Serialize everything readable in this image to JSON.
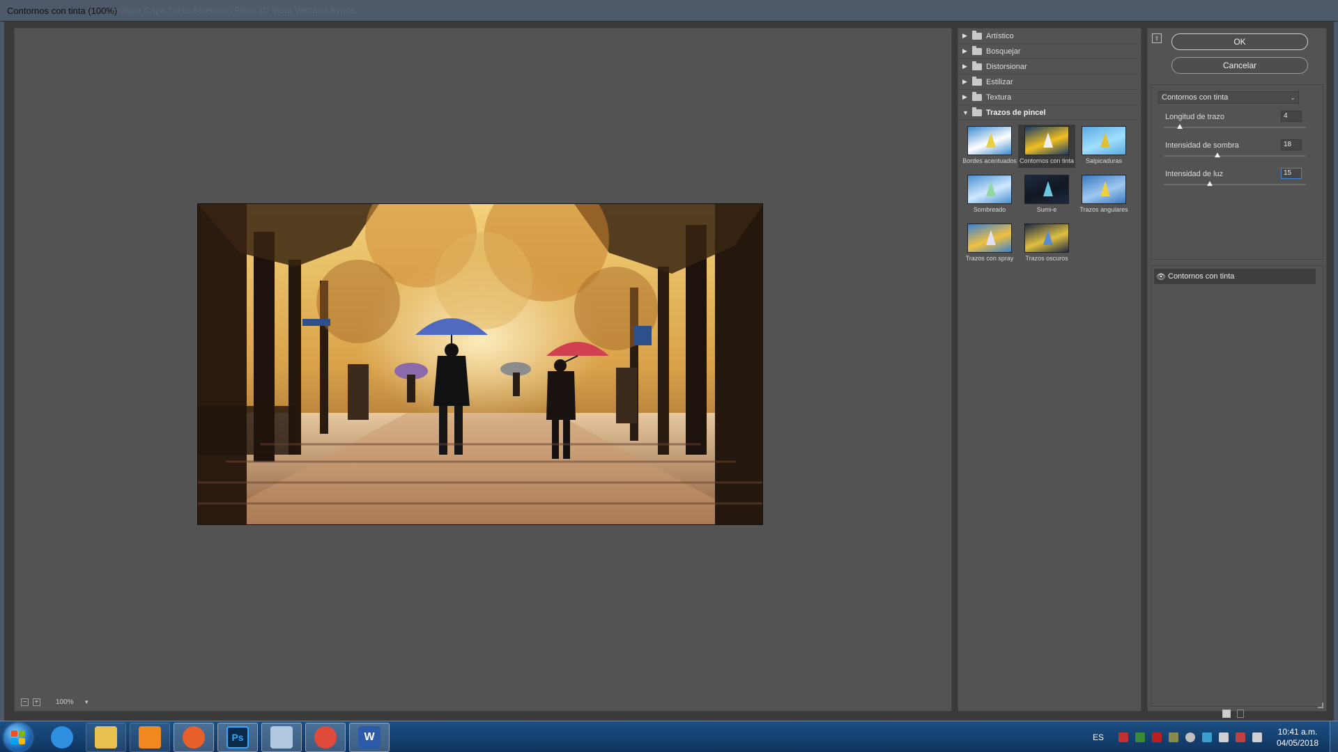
{
  "window": {
    "title": "Contornos con tinta (100%)",
    "ghost_menu": "Imagen   Capa   Texto   Selección   Filtro   3D   Vista   Ventana   Ayuda"
  },
  "preview": {
    "zoom_minus": "−",
    "zoom_plus": "+",
    "zoom_value": "100%"
  },
  "gallery": {
    "categories": [
      {
        "label": "Artístico",
        "open": false
      },
      {
        "label": "Bosquejar",
        "open": false
      },
      {
        "label": "Distorsionar",
        "open": false
      },
      {
        "label": "Estilizar",
        "open": false
      },
      {
        "label": "Textura",
        "open": false
      },
      {
        "label": "Trazos de pincel",
        "open": true
      }
    ],
    "filters": [
      {
        "label": "Bordes acentuados",
        "icon": "thumb-accented-edges"
      },
      {
        "label": "Contornos con tinta",
        "icon": "thumb-ink-outlines",
        "selected": true
      },
      {
        "label": "Salpicaduras",
        "icon": "thumb-spatter"
      },
      {
        "label": "Sombreado",
        "icon": "thumb-crosshatch"
      },
      {
        "label": "Sumi-e",
        "icon": "thumb-sumi-e"
      },
      {
        "label": "Trazos angulares",
        "icon": "thumb-angled-strokes"
      },
      {
        "label": "Trazos con spray",
        "icon": "thumb-sprayed-strokes"
      },
      {
        "label": "Trazos oscuros",
        "icon": "thumb-dark-strokes"
      }
    ]
  },
  "controls": {
    "ok_label": "OK",
    "cancel_label": "Cancelar",
    "filter_select": "Contornos con tinta",
    "params": [
      {
        "label": "Longitud de trazo",
        "value": "4",
        "min": 1,
        "max": 50,
        "num": 4
      },
      {
        "label": "Intensidad de sombra",
        "value": "18",
        "min": 0,
        "max": 50,
        "num": 18
      },
      {
        "label": "Intensidad de luz",
        "value": "15",
        "min": 0,
        "max": 50,
        "num": 15,
        "active": true
      }
    ],
    "layer_label": "Contornos con tinta"
  },
  "taskbar": {
    "language": "ES",
    "time": "10:41 a.m.",
    "date": "04/05/2018",
    "apps": [
      "internet-explorer",
      "file-explorer",
      "media-player",
      "firefox",
      "photoshop",
      "notepad",
      "chrome",
      "word"
    ]
  },
  "colors": {
    "accent_blue": "#4a86d0",
    "panel_gray": "#535353",
    "taskbar_blue": "#1c4f82"
  }
}
